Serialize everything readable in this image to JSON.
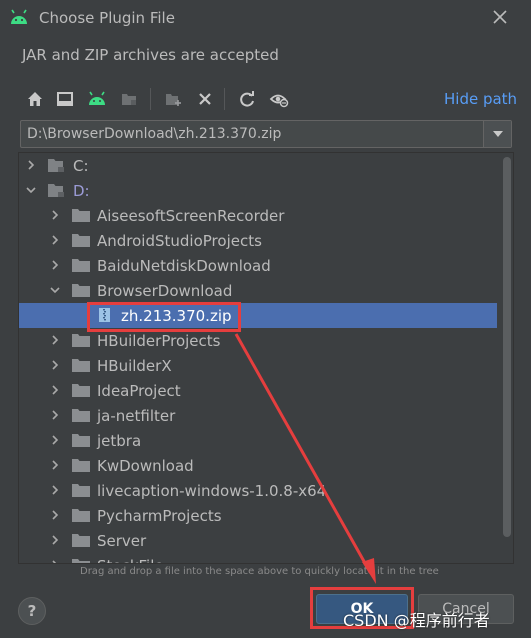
{
  "window": {
    "title": "Choose Plugin File",
    "subtitle": "JAR and ZIP archives are accepted",
    "app_icon": "android-icon",
    "close_icon": "close-icon"
  },
  "toolbar": {
    "buttons": [
      {
        "name": "home-icon"
      },
      {
        "name": "desktop-icon"
      },
      {
        "name": "android-project-icon"
      },
      {
        "name": "module-icon"
      },
      {
        "name": "new-folder-icon"
      },
      {
        "name": "delete-icon"
      },
      {
        "name": "refresh-icon"
      },
      {
        "name": "show-hidden-icon"
      }
    ],
    "hide_path_label": "Hide path"
  },
  "path": {
    "value": "D:\\BrowserDownload\\zh.213.370.zip"
  },
  "tree": {
    "items": [
      {
        "label": "C:",
        "depth": 0,
        "expanded": false,
        "type": "drive"
      },
      {
        "label": "D:",
        "depth": 0,
        "expanded": true,
        "type": "drive"
      },
      {
        "label": "AiseesoftScreenRecorder",
        "depth": 1,
        "expanded": false,
        "type": "folder"
      },
      {
        "label": "AndroidStudioProjects",
        "depth": 1,
        "expanded": false,
        "type": "folder"
      },
      {
        "label": "BaiduNetdiskDownload",
        "depth": 1,
        "expanded": false,
        "type": "folder"
      },
      {
        "label": "BrowserDownload",
        "depth": 1,
        "expanded": true,
        "type": "folder"
      },
      {
        "label": "zh.213.370.zip",
        "depth": 2,
        "expanded": null,
        "type": "zip",
        "selected": true
      },
      {
        "label": "HBuilderProjects",
        "depth": 1,
        "expanded": false,
        "type": "folder"
      },
      {
        "label": "HBuilderX",
        "depth": 1,
        "expanded": false,
        "type": "folder"
      },
      {
        "label": "IdeaProject",
        "depth": 1,
        "expanded": false,
        "type": "folder"
      },
      {
        "label": "ja-netfilter",
        "depth": 1,
        "expanded": false,
        "type": "folder"
      },
      {
        "label": "jetbra",
        "depth": 1,
        "expanded": false,
        "type": "folder"
      },
      {
        "label": "KwDownload",
        "depth": 1,
        "expanded": false,
        "type": "folder"
      },
      {
        "label": "livecaption-windows-1.0.8-x64",
        "depth": 1,
        "expanded": false,
        "type": "folder"
      },
      {
        "label": "PycharmProjects",
        "depth": 1,
        "expanded": false,
        "type": "folder"
      },
      {
        "label": "Server",
        "depth": 1,
        "expanded": false,
        "type": "folder"
      },
      {
        "label": "StockFile",
        "depth": 1,
        "expanded": false,
        "type": "folder"
      }
    ]
  },
  "hint": "Drag and drop a file into the space above to quickly locate it in the tree",
  "footer": {
    "help_label": "?",
    "ok_label": "OK",
    "cancel_label": "Cancel"
  },
  "watermark": "CSDN @程序前行者",
  "colors": {
    "background": "#3c3f41",
    "selection": "#4b6eaf",
    "link": "#589df6",
    "annotation": "#e53e3e",
    "android_green": "#3ddc84"
  }
}
